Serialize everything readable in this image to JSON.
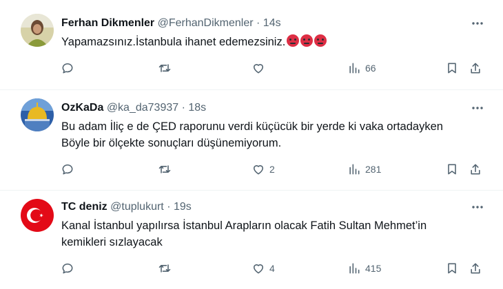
{
  "tweets": [
    {
      "name": "Ferhan Dikmenler",
      "handle": "@FerhanDikmenler",
      "separator": "·",
      "time": "14s",
      "text": "Yapamazsınız.İstanbula ihanet edemezsiniz.",
      "emoji": "😡😡😡",
      "replies": "",
      "retweets": "",
      "likes": "",
      "views": "66"
    },
    {
      "name": "OzKaDa",
      "handle": "@ka_da73937",
      "separator": "·",
      "time": "18s",
      "text_line1": "Bu adam İliç e de ÇED raporunu verdi küçücük bir yerde ki vaka ortadayken",
      "text_line2": "Böyle bir ölçekte sonuçları düşünemiyorum.",
      "replies": "",
      "retweets": "",
      "likes": "2",
      "views": "281"
    },
    {
      "name": "TC deniz",
      "handle": "@tuplukurt",
      "separator": "·",
      "time": "19s",
      "text_line1": "Kanal İstanbul yapılırsa İstanbul Arapların olacak Fatih Sultan Mehmet’in",
      "text_line2": "kemikleri sızlayacak",
      "replies": "",
      "retweets": "",
      "likes": "4",
      "views": "415"
    }
  ],
  "icons": {
    "reply": "reply-icon",
    "retweet": "retweet-icon",
    "like": "heart-icon",
    "views": "views-icon",
    "bookmark": "bookmark-icon",
    "share": "share-icon",
    "more": "more-icon"
  },
  "colors": {
    "text": "#0f1419",
    "secondary": "#536471",
    "divider": "#eff3f4",
    "flag_red": "#e30a17"
  }
}
